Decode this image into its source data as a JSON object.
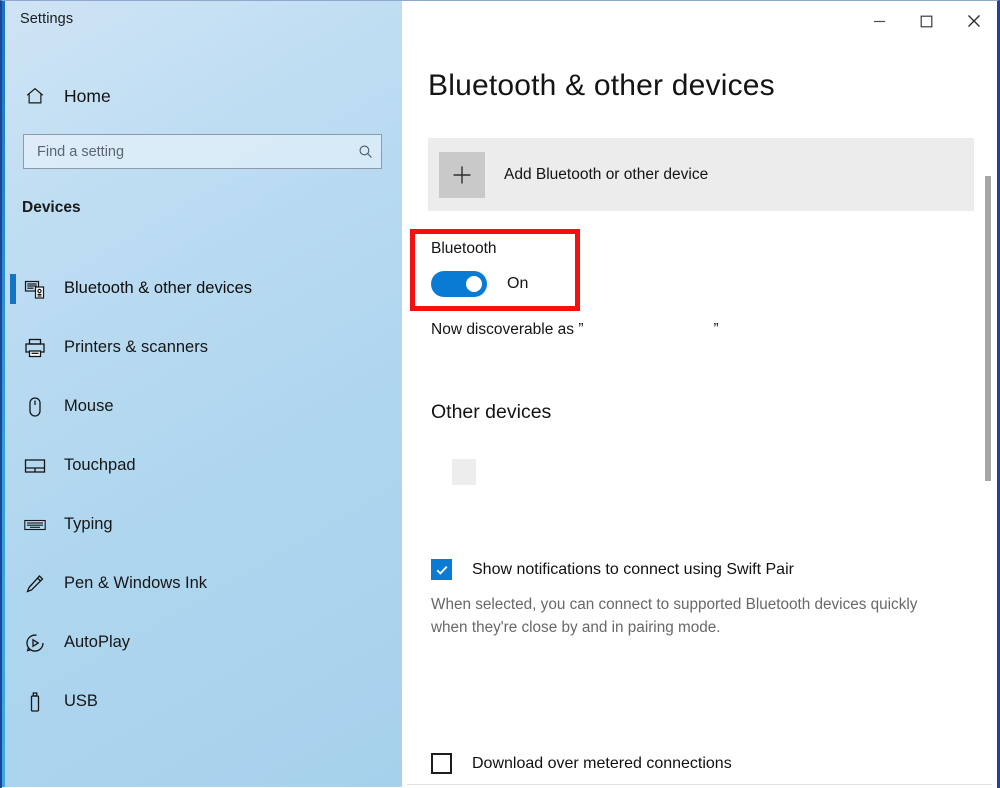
{
  "window": {
    "app_title": "Settings",
    "controls": [
      {
        "name": "minimize",
        "glyph": "minimize-icon"
      },
      {
        "name": "maximize",
        "glyph": "maximize-icon"
      },
      {
        "name": "close",
        "glyph": "close-icon"
      }
    ],
    "border_color": "#1b4697"
  },
  "sidebar": {
    "home_label": "Home",
    "home_icon": "home-icon",
    "search": {
      "value": "",
      "placeholder": "Find a setting",
      "icon": "search-icon"
    },
    "group_heading": "Devices",
    "accent_color": "#1673c4",
    "items": [
      {
        "label": "Bluetooth & other devices",
        "icon": "bluetooth-devices-icon",
        "selected": true
      },
      {
        "label": "Printers & scanners",
        "icon": "printer-icon",
        "selected": false
      },
      {
        "label": "Mouse",
        "icon": "mouse-icon",
        "selected": false
      },
      {
        "label": "Touchpad",
        "icon": "touchpad-icon",
        "selected": false
      },
      {
        "label": "Typing",
        "icon": "keyboard-icon",
        "selected": false
      },
      {
        "label": "Pen & Windows Ink",
        "icon": "pen-icon",
        "selected": false
      },
      {
        "label": "AutoPlay",
        "icon": "autoplay-icon",
        "selected": false
      },
      {
        "label": "USB",
        "icon": "usb-icon",
        "selected": false
      }
    ]
  },
  "main": {
    "page_title": "Bluetooth & other devices",
    "add_device": {
      "label": "Add Bluetooth or other device",
      "icon": "plus-icon"
    },
    "bluetooth": {
      "label": "Bluetooth",
      "toggle_state": "On",
      "toggle_on": true,
      "toggle_color": "#0a7bd4",
      "discoverable_prefix": "Now discoverable as ”",
      "discoverable_name": "",
      "discoverable_suffix": "”"
    },
    "other_devices": {
      "heading": "Other devices"
    },
    "swift_pair": {
      "label": "Show notifications to connect using Swift Pair",
      "checked": true,
      "description": "When selected, you can connect to supported Bluetooth devices quickly when they're close by and in pairing mode."
    },
    "metered": {
      "label": "Download over metered connections",
      "checked": false
    }
  },
  "annotation": {
    "highlight_color": "#f31010",
    "target": "bluetooth-toggle"
  }
}
